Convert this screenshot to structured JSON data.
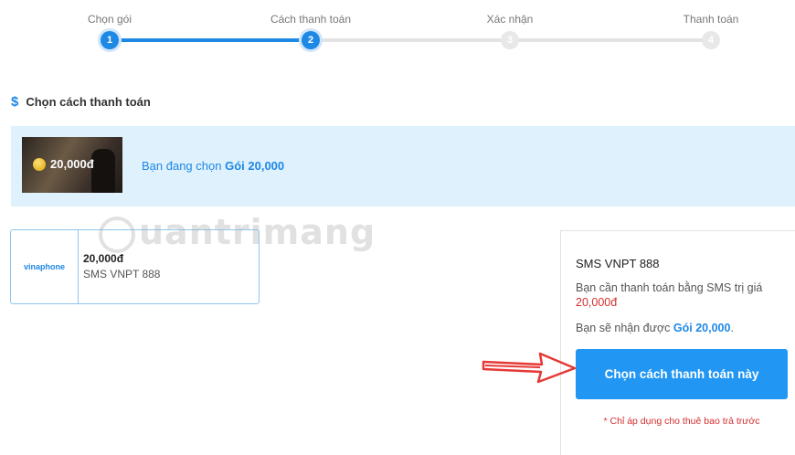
{
  "stepper": {
    "steps": [
      {
        "label": "Chọn gói",
        "number": "1",
        "active": true
      },
      {
        "label": "Cách thanh toán",
        "number": "2",
        "active": true
      },
      {
        "label": "Xác nhận",
        "number": "3",
        "active": false
      },
      {
        "label": "Thanh toán",
        "number": "4",
        "active": false
      }
    ]
  },
  "section": {
    "icon": "dollar-icon",
    "title": "Chọn cách thanh toán"
  },
  "banner": {
    "thumb_price": "20,000đ",
    "text_prefix": "Bạn đang chọn",
    "package": "Gói 20,000"
  },
  "method": {
    "logo": "vinaphone",
    "price": "20,000đ",
    "name": "SMS VNPT 888"
  },
  "detail": {
    "title": "SMS VNPT 888",
    "desc": "Bạn cần thanh toán bằng SMS trị giá",
    "amount": "20,000đ",
    "receive_prefix": "Bạn sẽ nhận được",
    "receive_package": "Gói 20,000",
    "receive_suffix": ".",
    "button_label": "Chọn cách thanh toán này",
    "note": "* Chỉ áp dụng cho thuê bao trả trước"
  },
  "watermark": {
    "text": "uantrimang"
  },
  "colors": {
    "accent": "#2196f3",
    "highlight": "#d32f2f",
    "banner_bg": "#dff1fd"
  }
}
